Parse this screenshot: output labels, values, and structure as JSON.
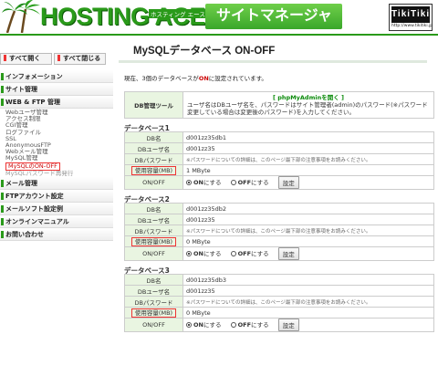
{
  "header": {
    "logo": "HOSTING ACE",
    "logo_sub": "ホスティング エース",
    "site_manager": "サイトマネージャー",
    "brand": "TikiTiki",
    "brand_sub": "http://www.tikitiki.jp"
  },
  "sidebar": {
    "expand_all": "すべて開く",
    "collapse_all": "すべて閉じる",
    "items_top": [
      "インフォメーション",
      "サイト管理",
      "WEB & FTP 管理"
    ],
    "sub_items": [
      "Webユーザ管理",
      "アクセス制限",
      "CGI管理",
      "ログファイル",
      "SSL",
      "AnonymousFTP",
      "Webメール管理",
      "MySQL管理"
    ],
    "sub_active": "MySQLのON-OFF",
    "sub_last": "MySQLパスワード再発行",
    "items_bottom": [
      "メール管理",
      "FTPアカウント設定",
      "メールソフト設定例",
      "オンラインマニュアル",
      "お問い合わせ"
    ]
  },
  "main": {
    "title": "MySQLデータベース ON-OFF",
    "intro_prefix": "現在、3個のデータベースが",
    "intro_on": "ON",
    "intro_suffix": "に設定されています。",
    "tool": {
      "label": "DB管理ツール",
      "link": "[ phpMyAdminを開く ]",
      "desc": "ユーザ名はDBユーザ名を、パスワードはサイト管理者(admin)のパスワード(※パスワード変更している場合は変更後のパスワード)を入力してください。"
    },
    "labels": {
      "db_name": "DB名",
      "db_user": "DBユーザ名",
      "db_pass": "DBパスワード",
      "usage": "使用容量(MB)",
      "onoff": "ON/OFF",
      "pass_note": "※パスワードについての詳細は、このページ最下部の注意事項をお読みください。",
      "on_label_prefix": "ON",
      "on_label_suffix": "にする",
      "off_label_prefix": "OFF",
      "off_label_suffix": "にする",
      "set_button": "設定"
    },
    "databases": [
      {
        "title": "データベース1",
        "name": "d001zz35db1",
        "user": "d001zz35",
        "usage": "1 MByte"
      },
      {
        "title": "データベース2",
        "name": "d001zz35db2",
        "user": "d001zz35",
        "usage": "0 MByte"
      },
      {
        "title": "データベース3",
        "name": "d001zz35db3",
        "user": "d001zz35",
        "usage": "0 MByte"
      }
    ]
  }
}
